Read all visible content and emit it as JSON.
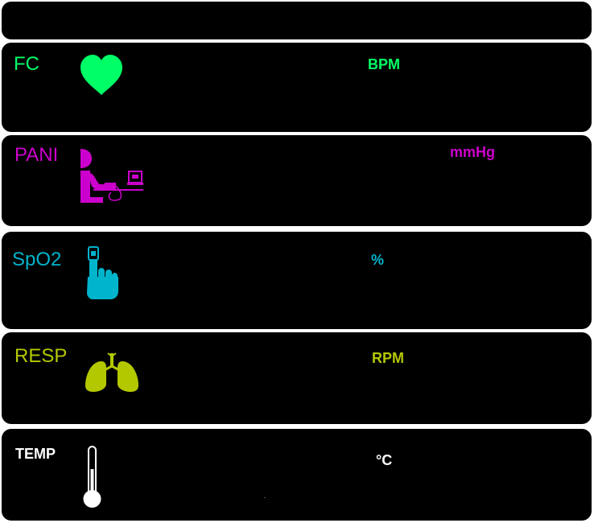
{
  "colors": {
    "fc": "#00ff66",
    "pani": "#cc00cc",
    "spo2": "#00b4cc",
    "resp": "#b4c800",
    "temp": "#ffffff"
  },
  "fc": {
    "label": "FC",
    "unit": "BPM",
    "icon": "heart-icon"
  },
  "pani": {
    "label": "PANI",
    "unit": "mmHg",
    "icon": "blood-pressure-icon"
  },
  "spo2": {
    "label": "SpO2",
    "unit": "%",
    "icon": "finger-pulse-oximeter-icon"
  },
  "resp": {
    "label": "RESP",
    "unit": "RPM",
    "icon": "lungs-icon"
  },
  "temp": {
    "label": "TEMP",
    "unit": "°C",
    "icon": "thermometer-icon"
  }
}
